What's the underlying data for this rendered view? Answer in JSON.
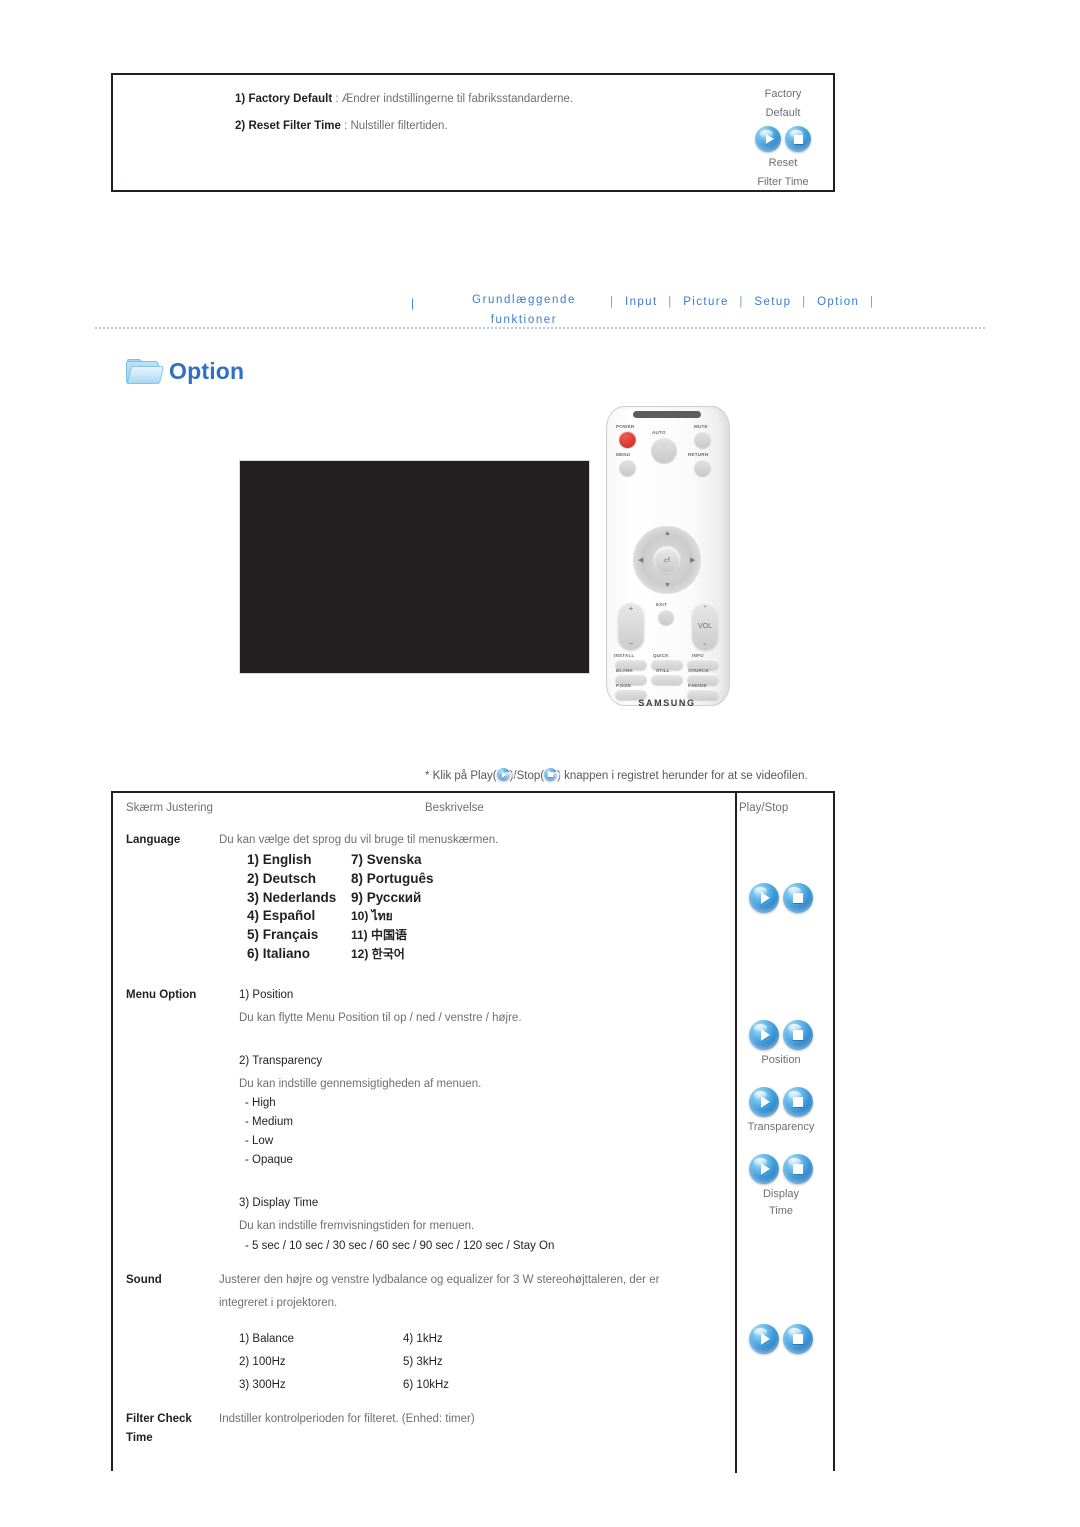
{
  "top_panel": {
    "items": [
      {
        "num": "1)",
        "term": "Factory Default",
        "colon": " : ",
        "desc": "Ændrer indstillingerne til fabriksstandarderne."
      },
      {
        "num": "2)",
        "term": "Reset Filter Time",
        "colon": " : ",
        "desc": "Nulstiller filtertiden."
      }
    ],
    "button_label_top_line1": "Factory",
    "button_label_top_line2": "Default",
    "button_label_bottom_line1": "Reset",
    "button_label_bottom_line2": "Filter Time"
  },
  "nav": {
    "left_line1": "Grundlæggende",
    "left_line2": "funktioner",
    "separator": "|",
    "items": [
      "Input",
      "Picture",
      "Setup",
      "Option"
    ],
    "accent_color": "#3b7cd1"
  },
  "section": {
    "icon": "folder-icon",
    "title": "Option"
  },
  "note": {
    "prefix": "* Klik på Play(",
    "middle": ")/Stop(",
    "suffix": ") knappen i registret herunder for at se videofilen."
  },
  "remote": {
    "brand": "SAMSUNG",
    "labels": {
      "power": "POWER",
      "auto": "AUTO",
      "mute": "MUTE",
      "menu": "MENU",
      "return": "RETURN",
      "exit": "EXIT",
      "vol": "VOL",
      "install": "INSTALL",
      "quick": "QUICK",
      "info": "INFO",
      "blank": "BLANK",
      "still": "STILL",
      "source": "SOURCE",
      "psize": "P.SIZE",
      "pmode": "P.MODE"
    }
  },
  "table": {
    "headers": [
      "Skærm Justering",
      "Beskrivelse",
      "Play/Stop"
    ],
    "rows": [
      {
        "label": "Language",
        "description": "Du kan vælge det sprog du vil bruge til menuskærmen.",
        "language_list_left": [
          "1) English",
          "2) Deutsch",
          "3) Nederlands",
          "4) Español",
          "5) Français",
          "6) Italiano"
        ],
        "language_list_right": [
          "7) Svenska",
          "8) Português",
          "9) Русский",
          "10) ไทย",
          "11) 中国语",
          "12) 한국어"
        ]
      },
      {
        "label": "Menu Option",
        "sub1_title": "1) Position",
        "sub1_desc": "Du kan flytte Menu Position til op / ned / venstre / højre.",
        "sub2_title": "2) Transparency",
        "sub2_desc": "Du kan indstille gennemsigtigheden af menuen.",
        "sub2_options": [
          "- High",
          "- Medium",
          "- Low",
          "- Opaque"
        ],
        "sub3_title": "3) Display Time",
        "sub3_desc": "Du kan indstille fremvisningstiden for menuen.",
        "sub3_options": [
          "- 5 sec / 10 sec / 30 sec / 60 sec / 90 sec / 120 sec / Stay On"
        ],
        "btn_label_1": "Position",
        "btn_label_2": "Transparency",
        "btn_label_3a": "Display",
        "btn_label_3b": "Time"
      },
      {
        "label": "Sound",
        "desc_line1": "Justerer den højre og venstre lydbalance og equalizer for 3 W stereohøjttaleren, der er",
        "desc_line2": "integreret i projektoren.",
        "options_left": [
          "1) Balance",
          "2) 100Hz",
          "3) 300Hz"
        ],
        "options_right": [
          "4) 1kHz",
          "5) 3kHz",
          "6) 10kHz"
        ]
      },
      {
        "label_line1": "Filter Check",
        "label_line2": "Time",
        "description": "Indstiller kontrolperioden for filteret. (Enhed: timer)"
      }
    ]
  }
}
